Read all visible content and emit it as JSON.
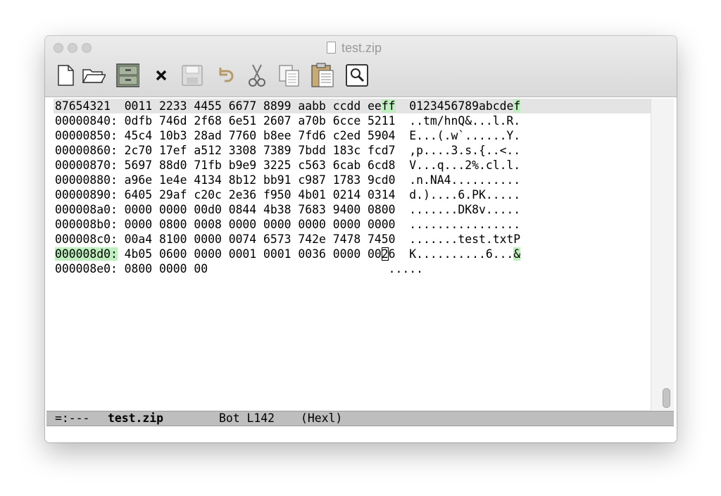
{
  "window": {
    "title": "test.zip"
  },
  "toolbar": {
    "buttons": [
      {
        "name": "new-file",
        "icon": "new-file-icon"
      },
      {
        "name": "open-folder",
        "icon": "folder-open-icon"
      },
      {
        "name": "save-cabinet",
        "icon": "filing-cabinet-icon"
      },
      {
        "name": "close",
        "icon": "close-icon"
      },
      {
        "name": "save",
        "icon": "floppy-disk-icon"
      },
      {
        "name": "undo",
        "icon": "undo-icon"
      },
      {
        "name": "cut",
        "icon": "scissors-icon"
      },
      {
        "name": "copy",
        "icon": "copy-icon"
      },
      {
        "name": "paste",
        "icon": "paste-icon"
      },
      {
        "name": "search",
        "icon": "magnifier-icon"
      }
    ]
  },
  "hexl": {
    "header": {
      "offset_label": "87654321",
      "columns": "  0011 2233 4455 6677 8899 aabb ccdd ee",
      "columns_hl": "ff",
      "ascii": "  0123456789abcde",
      "ascii_hl": "f"
    },
    "rows": [
      {
        "addr": "00000840:",
        "hex": " 0dfb 746d 2f68 6e51 2607 a70b 6cce 5211",
        "ascii": "  ..tm/hnQ&...l.R."
      },
      {
        "addr": "00000850:",
        "hex": " 45c4 10b3 28ad 7760 b8ee 7fd6 c2ed 5904",
        "ascii": "  E...(.w`......Y."
      },
      {
        "addr": "00000860:",
        "hex": " 2c70 17ef a512 3308 7389 7bdd 183c fcd7",
        "ascii": "  ,p....3.s.{..<.."
      },
      {
        "addr": "00000870:",
        "hex": " 5697 88d0 71fb b9e9 3225 c563 6cab 6cd8",
        "ascii": "  V...q...2%.cl.l."
      },
      {
        "addr": "00000880:",
        "hex": " a96e 1e4e 4134 8b12 bb91 c987 1783 9cd0",
        "ascii": "  .n.NA4.........."
      },
      {
        "addr": "00000890:",
        "hex": " 6405 29af c20c 2e36 f950 4b01 0214 0314",
        "ascii": "  d.)....6.PK....."
      },
      {
        "addr": "000008a0:",
        "hex": " 0000 0000 00d0 0844 4b38 7683 9400 0800",
        "ascii": "  .......DK8v....."
      },
      {
        "addr": "000008b0:",
        "hex": " 0000 0800 0008 0000 0000 0000 0000 0000",
        "ascii": "  ................"
      },
      {
        "addr": "000008c0:",
        "hex": " 00a4 8100 0000 0074 6573 742e 7478 7450",
        "ascii": "  .......test.txtP"
      }
    ],
    "current_row": {
      "addr": "000008d0:",
      "hex_before": " 4b05 0600 0000 0001 0001 0036 0000 00",
      "cursor_char": "2",
      "hex_after": "6",
      "ascii": "  K..........6...",
      "ascii_hl": "&"
    },
    "last_row": {
      "addr": "000008e0:",
      "hex": " 0800 0000 00",
      "ascii": "                          ....."
    }
  },
  "modeline": {
    "status": "=:---",
    "buffer": "test.zip",
    "position": "Bot L142",
    "mode": "(Hexl)"
  }
}
